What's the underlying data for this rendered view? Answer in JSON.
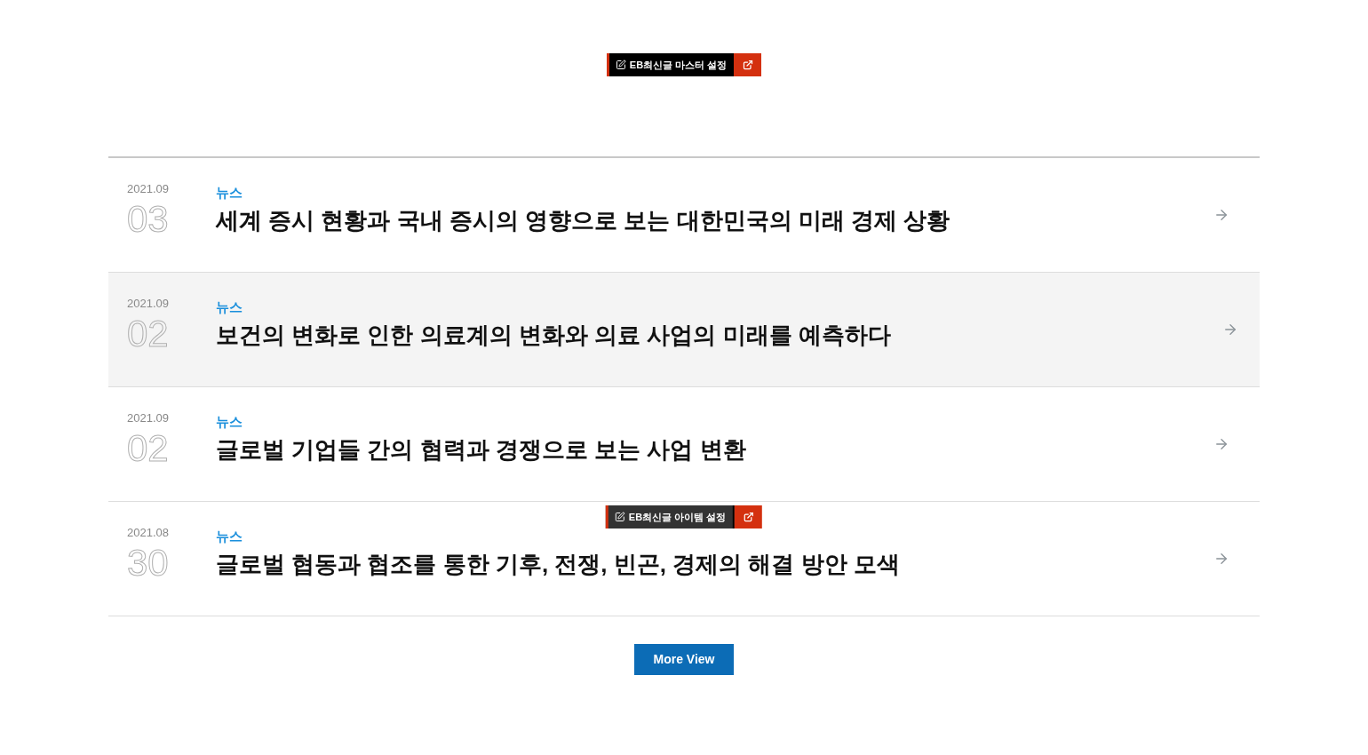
{
  "master_toolbar": {
    "kind": "master",
    "label": "EB최신글 마스터 설정"
  },
  "news_list": {
    "items": [
      {
        "date": "2021.09",
        "day": "03",
        "category": "뉴스",
        "title": "세계 증시 현황과 국내 증시의 영향으로 보는 대한민국의 미래 경제 상황",
        "highlighted": false
      },
      {
        "date": "2021.09",
        "day": "02",
        "category": "뉴스",
        "title": "보건의 변화로 인한 의료계의 변화와 의료 사업의 미래를 예측하다",
        "highlighted": true
      },
      {
        "date": "2021.09",
        "day": "02",
        "category": "뉴스",
        "title": "글로벌 기업들 간의 협력과 경쟁으로 보는 사업 변환",
        "highlighted": false
      },
      {
        "date": "2021.08",
        "day": "30",
        "category": "뉴스",
        "title": "글로벌 협동과 협조를 통한 기후, 전쟁, 빈곤, 경제의 해결 방안 모색",
        "highlighted": false,
        "toolbar": {
          "kind": "item",
          "label": "EB최신글 아이템 설정"
        }
      }
    ]
  },
  "more_button": {
    "label": "More View"
  }
}
